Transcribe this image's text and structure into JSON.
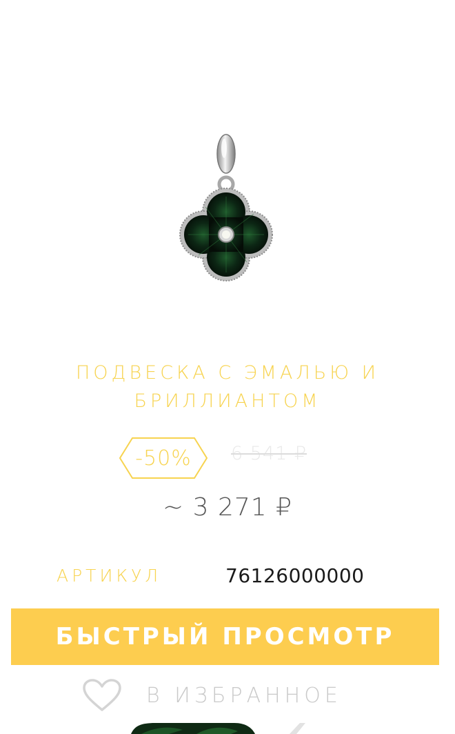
{
  "product": {
    "image_icon": "pendant-image",
    "title_line1": "ПОДВЕСКА С ЭМАЛЬЮ И",
    "title_line2": "БРИЛЛИАНТОМ",
    "discount": "-50%",
    "old_price": "6 541 ₽",
    "new_price": "~ 3 271 ₽",
    "sku_label": "АРТИКУЛ",
    "sku_value": "76126000000"
  },
  "actions": {
    "quick_view_label": "БЫСТРЫЙ ПРОСМОТР",
    "favorite_label": "В ИЗБРАННОЕ",
    "favorite_icon": "heart-icon"
  },
  "colors": {
    "accent": "#f7d34f",
    "button": "#fdcd4f",
    "enamel": "#0b1a10"
  }
}
